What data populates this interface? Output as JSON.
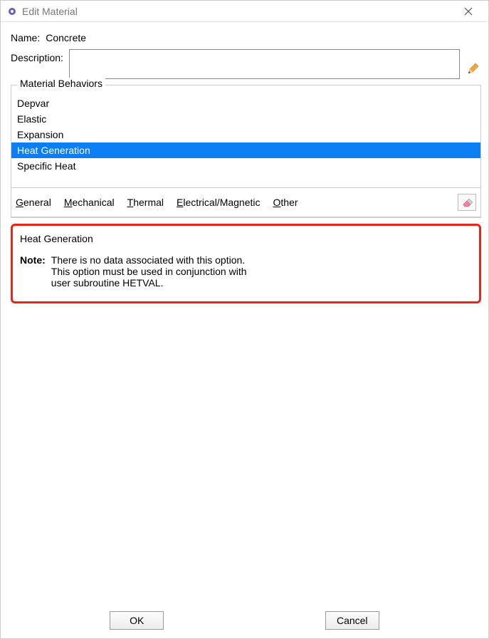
{
  "window": {
    "title": "Edit Material"
  },
  "form": {
    "name_label": "Name:",
    "name_value": "Concrete",
    "description_label": "Description:",
    "description_value": ""
  },
  "behaviors": {
    "legend": "Material Behaviors",
    "items": [
      {
        "label": "Depvar",
        "selected": false
      },
      {
        "label": "Elastic",
        "selected": false
      },
      {
        "label": "Expansion",
        "selected": false
      },
      {
        "label": "Heat Generation",
        "selected": true
      },
      {
        "label": "Specific Heat",
        "selected": false
      }
    ]
  },
  "menus": {
    "general": "General",
    "mechanical": "Mechanical",
    "thermal": "Thermal",
    "electrical": "Electrical/Magnetic",
    "other": "Other"
  },
  "detail": {
    "title": "Heat Generation",
    "note_label": "Note:",
    "note_text": "There is no data associated with this option.\nThis option must be used in conjunction with\nuser subroutine HETVAL."
  },
  "buttons": {
    "ok": "OK",
    "cancel": "Cancel"
  }
}
